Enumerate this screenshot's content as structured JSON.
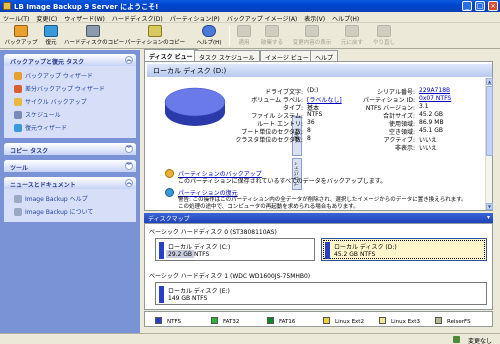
{
  "window": {
    "title": "LB Image Backup 9 Server にようこそ!"
  },
  "menu": [
    "ツール(T)",
    "変更(C)",
    "ウィザード(W)",
    "ハードディスク(D)",
    "パーティション(P)",
    "バックアップ イメージ(A)",
    "表示(V)",
    "ヘルプ(H)"
  ],
  "toolbar": {
    "backup": "バックアップ",
    "restore": "復元",
    "hdd_copy": "ハードディスクのコピー",
    "partition_copy": "パーティションのコピー",
    "help": "ヘルプ(H)",
    "apply": "適用",
    "abort": "破棄する",
    "cancel_change": "変更内容の表示",
    "undo": "元に戻す",
    "redo": "やり直し"
  },
  "sidebar": {
    "tasks_title": "バックアップと復元 タスク",
    "tasks": [
      "バックアップ ウィザード",
      "差分バックアップ ウィザード",
      "サイクル バックアップ",
      "スケジュール",
      "復元ウィザード"
    ],
    "copy_title": "コピー タスク",
    "tools_title": "ツール",
    "news_title": "ニュースとドキュメント",
    "news": [
      "Image Backup ヘルプ",
      "Image Backup について"
    ]
  },
  "tabs": [
    "ディスク ビュー",
    "タスク スケジュール",
    "イメージ ビュー",
    "ヘルプ"
  ],
  "diskview": {
    "title": "ローカル ディスク (D:)",
    "props_left": [
      {
        "label": "ドライブ文字:",
        "value": "(D:)",
        "link": false
      },
      {
        "label": "ボリューム ラベル:",
        "value": "[ラベルなし]",
        "link": true
      },
      {
        "label": "タイプ:",
        "value": "基本",
        "link": false
      },
      {
        "label": "ファイル システム:",
        "value": "NTFS",
        "link": false
      },
      {
        "label": "ルート エントリ:",
        "value": "36",
        "link": false
      },
      {
        "label": "ブート単位のセクタ数:",
        "value": "8",
        "link": false
      },
      {
        "label": "クラスタ単位のセクタ数:",
        "value": "8",
        "link": false
      }
    ],
    "props_right": [
      {
        "label": "シリアル番号:",
        "value": "229A718B",
        "link": true
      },
      {
        "label": "パーティション ID:",
        "value": "0x07 NTFS",
        "link": true
      },
      {
        "label": "NTFS バージョン:",
        "value": "3.1",
        "link": false
      },
      {
        "label": "合計サイズ:",
        "value": "45.2 GB",
        "link": false
      },
      {
        "label": "使用領域:",
        "value": "86.9 MB",
        "link": false
      },
      {
        "label": "空き領域:",
        "value": "45.1 GB",
        "link": false
      },
      {
        "label": "アクティブ:",
        "value": "いいえ",
        "link": false
      },
      {
        "label": "非表示:",
        "value": "いいえ",
        "link": false
      }
    ],
    "side_tab_ops": "操作",
    "side_tab_props": "プロパティ",
    "op_backup_title": "パーティションのバックアップ",
    "op_backup_desc": "このパーティションに保存されているすべてのデータをバックアップします。",
    "op_restore_title": "パーティションの復元",
    "op_restore_desc": "警告: この操作はこのパーティション内の全データが削除され、選択したイメージからのデータに置き換えられます。",
    "op_restore_desc2": "この処理の途中で、コンピュータの再起動を求められる場合もあります。"
  },
  "diskmap": {
    "header": "ディスクマップ",
    "disk0": {
      "title": "ベーシック ハードディスク 0 (ST3808110AS)",
      "partitions": [
        {
          "name": "ローカル ディスク (C:)",
          "size": "29.2 GB NTFS"
        },
        {
          "name": "ローカル ディスク (D:)",
          "size": "45.2 GB NTFS"
        }
      ]
    },
    "disk1": {
      "title": "ベーシック ハードディスク 1 (WDC WD1600JS-75MHB0)",
      "partitions": [
        {
          "name": "ローカル ディスク (E:)",
          "size": "149 GB NTFS"
        }
      ]
    }
  },
  "legend": [
    {
      "label": "NTFS",
      "color": "#2840c8"
    },
    {
      "label": "FAT32",
      "color": "#2ab43a"
    },
    {
      "label": "FAT16",
      "color": "#0a8a2a"
    },
    {
      "label": "Linux Ext2",
      "color": "#e8d040"
    },
    {
      "label": "Linux Ext3",
      "color": "#f0e890"
    },
    {
      "label": "ReiserFS",
      "color": "#b8b890"
    }
  ],
  "statusbar": {
    "status": "変更なし"
  },
  "colors": {
    "sidebar_bg": "#7a92d6",
    "disk_fill": "#5a6ee0",
    "accent": "#1f42b8"
  }
}
